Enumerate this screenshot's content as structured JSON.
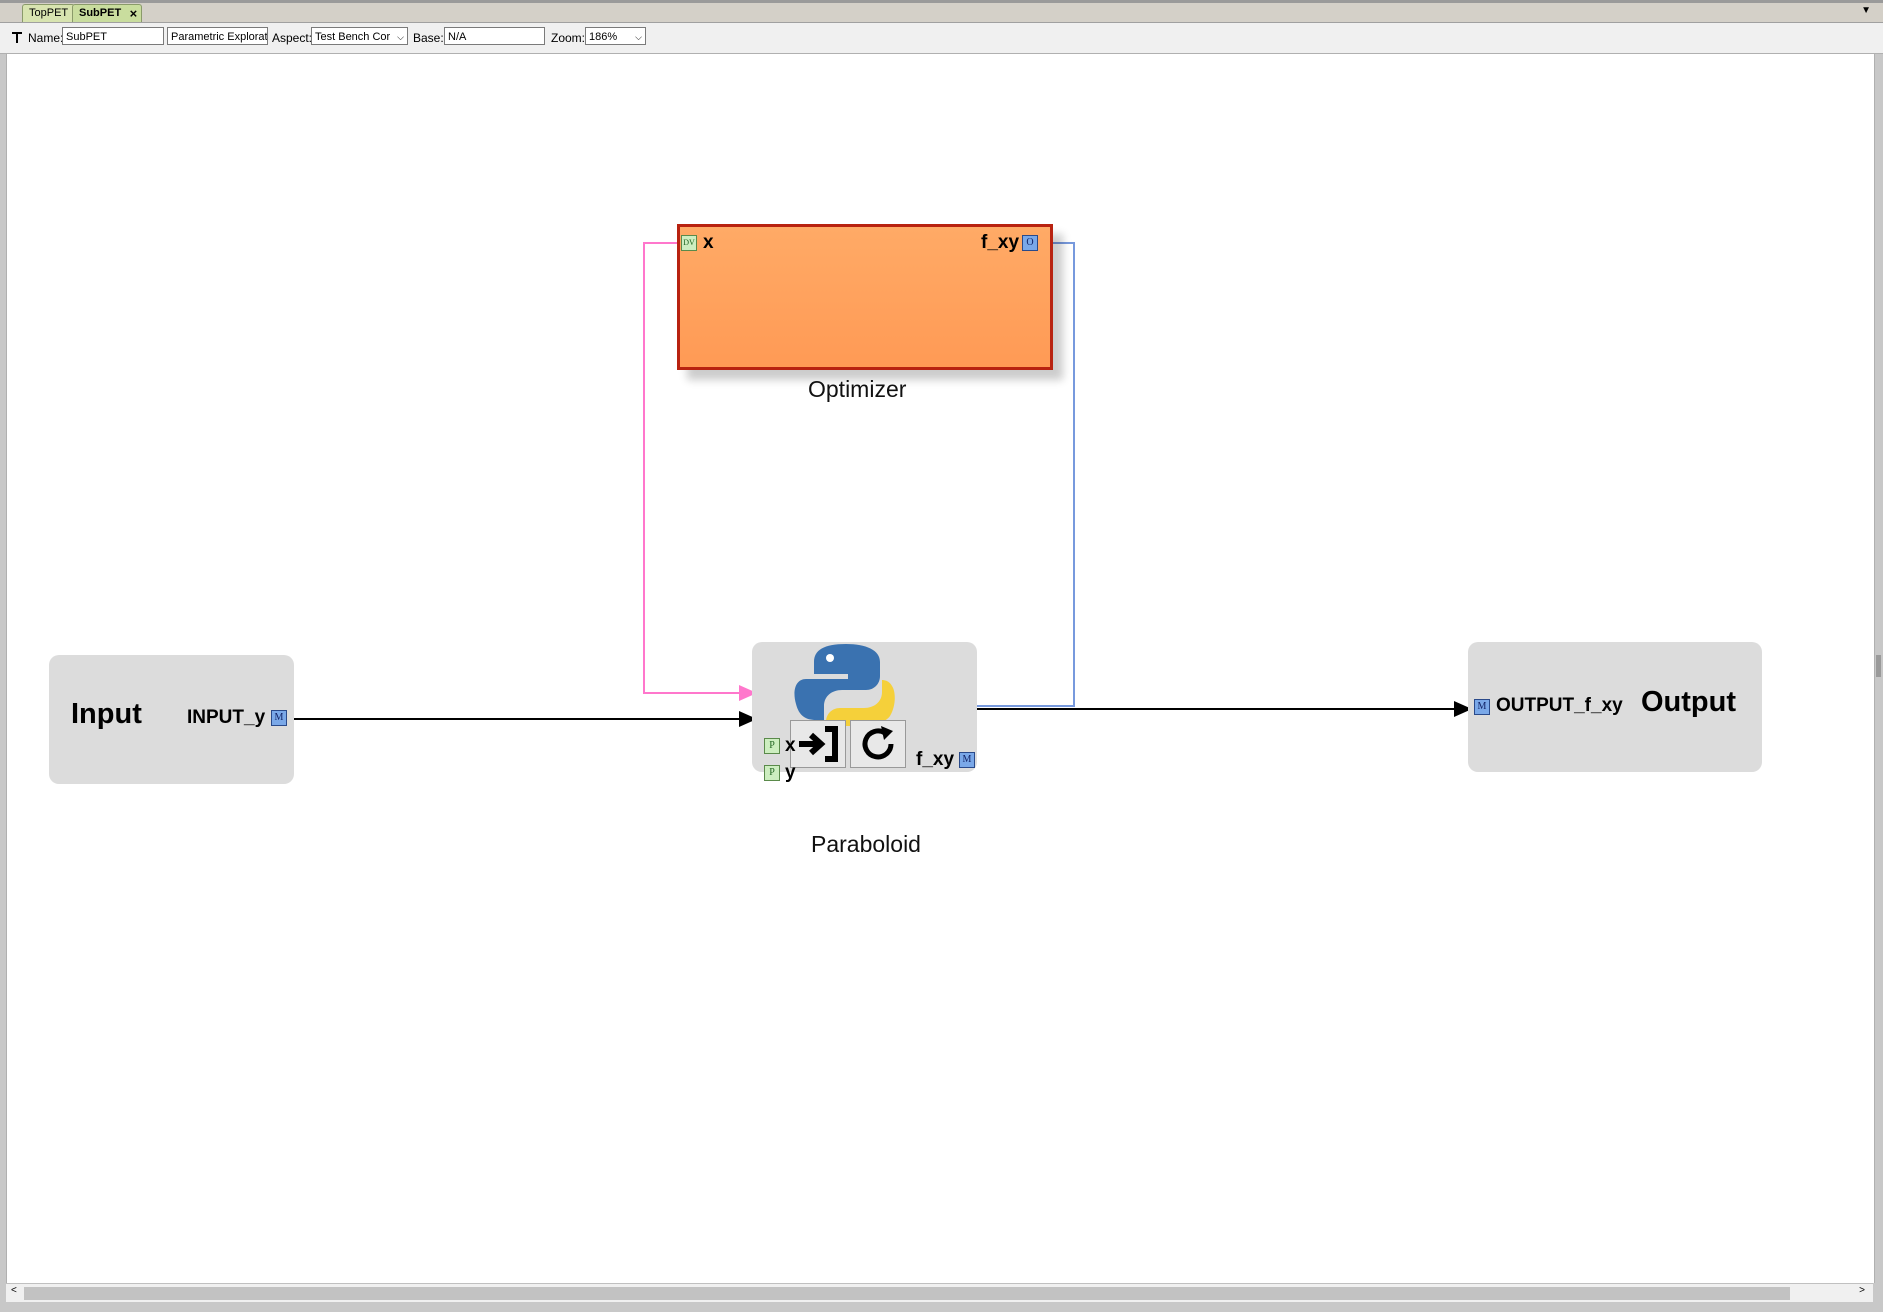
{
  "tabs": [
    {
      "label": "TopPET",
      "active": false
    },
    {
      "label": "SubPET",
      "active": true,
      "close": "×"
    }
  ],
  "tab_menu_icon": "▼",
  "toolbar": {
    "name_label": "Name:",
    "name_value": "SubPET",
    "kind_value": "Parametric Exploration",
    "aspect_label": "Aspect:",
    "aspect_value": "Test Bench Cor",
    "base_label": "Base:",
    "base_value": "N/A",
    "zoom_label": "Zoom:",
    "zoom_value": "186%"
  },
  "diagram": {
    "optimizer": {
      "name": "Optimizer",
      "input_port": {
        "tag": "DV",
        "label": "x"
      },
      "output_port": {
        "tag": "O",
        "label": "f_xy"
      }
    },
    "paraboloid": {
      "name": "Paraboloid",
      "ports_in": [
        {
          "tag": "P",
          "label": "x"
        },
        {
          "tag": "P",
          "label": "y"
        }
      ],
      "port_out": {
        "tag": "M",
        "label": "f_xy"
      }
    },
    "input_block": {
      "name": "Input",
      "port": {
        "tag": "M",
        "label": "INPUT_y"
      }
    },
    "output_block": {
      "name": "Output",
      "port": {
        "tag": "M",
        "label": "OUTPUT_f_xy"
      }
    },
    "connection_colors": {
      "design_variable": "#ff77cc",
      "objective": "#7799dd",
      "data": "#000000",
      "optimizer_fill": "#ffa05f",
      "optimizer_border": "#b82210"
    }
  },
  "scrollbar": {
    "left": "<",
    "right": ">"
  }
}
